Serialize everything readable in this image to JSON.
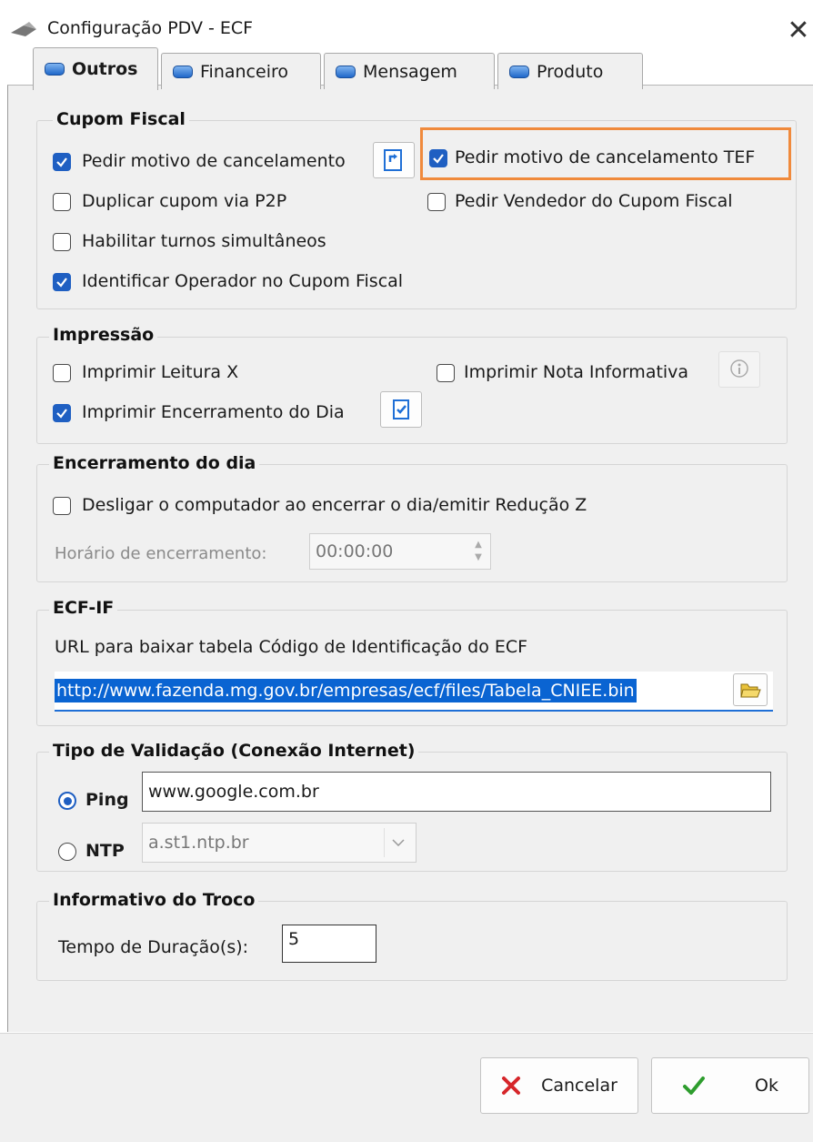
{
  "window": {
    "title": "Configuração PDV - ECF",
    "close_glyph": "✕"
  },
  "tabs": [
    {
      "label": "Outros",
      "active": true
    },
    {
      "label": "Financeiro",
      "active": false
    },
    {
      "label": "Mensagem",
      "active": false
    },
    {
      "label": "Produto",
      "active": false
    }
  ],
  "cupom_fiscal": {
    "title": "Cupom Fiscal",
    "pedir_motivo": {
      "label": "Pedir motivo de cancelamento",
      "checked": true
    },
    "pedir_motivo_tef": {
      "label": "Pedir motivo de cancelamento TEF",
      "checked": true
    },
    "duplicar_cupom": {
      "label": "Duplicar cupom via P2P",
      "checked": false
    },
    "pedir_vendedor": {
      "label": "Pedir Vendedor do Cupom Fiscal",
      "checked": false
    },
    "turnos": {
      "label": "Habilitar turnos simultâneos",
      "checked": false
    },
    "identificar_operador": {
      "label": "Identificar Operador no Cupom Fiscal",
      "checked": true
    }
  },
  "impressao": {
    "title": "Impressão",
    "leitura_x": {
      "label": "Imprimir Leitura X",
      "checked": false
    },
    "nota_informativa": {
      "label": "Imprimir Nota Informativa",
      "checked": false
    },
    "encerramento_dia": {
      "label": "Imprimir Encerramento do Dia",
      "checked": true
    }
  },
  "encerramento": {
    "title": "Encerramento do dia",
    "desligar": {
      "label": "Desligar o computador ao encerrar o dia/emitir Redução Z",
      "checked": false
    },
    "horario_label": "Horário de encerramento:",
    "horario_value": "00:00:00"
  },
  "ecf_if": {
    "title": "ECF-IF",
    "url_label": "URL para baixar tabela Código de Identificação do ECF",
    "url_value": "http://www.fazenda.mg.gov.br/empresas/ecf/files/Tabela_CNIEE.bin"
  },
  "validacao": {
    "title": "Tipo de Validação (Conexão Internet)",
    "ping": {
      "label": "Ping",
      "selected": true,
      "value": "www.google.com.br"
    },
    "ntp": {
      "label": "NTP",
      "selected": false,
      "value": "a.st1.ntp.br"
    }
  },
  "troco": {
    "title": "Informativo do Troco",
    "tempo_label": "Tempo de Duração(s):",
    "tempo_value": "5"
  },
  "buttons": {
    "cancelar": "Cancelar",
    "ok": "Ok"
  },
  "colors": {
    "accent": "#1f5fc2",
    "highlight": "#f08a3c",
    "cancel_icon": "#d6262a",
    "ok_icon": "#2e9d2e"
  }
}
